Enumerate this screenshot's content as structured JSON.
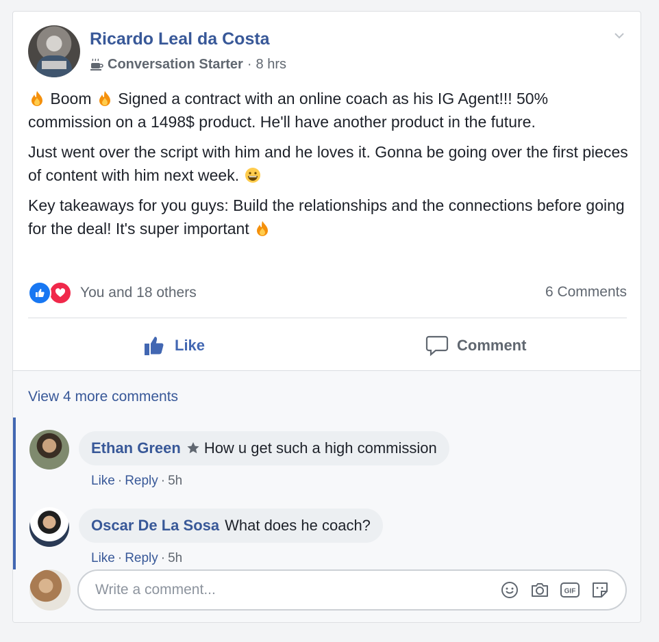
{
  "post": {
    "author": "Ricardo Leal da Costa",
    "badge_label": "Conversation Starter",
    "separator": "·",
    "time": "8 hrs",
    "text": {
      "p1_boom": "Boom",
      "p1_rest": "Signed a contract with an online coach as his IG Agent!!! 50% commission on a 1498$ product. He'll have another product in the future.",
      "p2": "Just went over the script with him and he loves it. Gonna be going over the first pieces of content with him next week.",
      "p3": "Key takeaways for you guys: Build the relationships and the connections before going for the deal! It's super important"
    },
    "reactions_text": "You and 18 others",
    "comments_count": "6 Comments"
  },
  "actions": {
    "like_label": "Like",
    "comment_label": "Comment"
  },
  "comments": {
    "view_more": "View 4 more comments",
    "items": [
      {
        "name": "Ethan Green",
        "text": "How u get such a high commission",
        "like": "Like",
        "reply": "Reply",
        "time": "5h"
      },
      {
        "name": "Oscar De La Sosa",
        "text": "What does he coach?",
        "like": "Like",
        "reply": "Reply",
        "time": "5h"
      }
    ],
    "write_placeholder": "Write a comment..."
  },
  "colors": {
    "link_blue": "#385898",
    "like_blue": "#4267b2",
    "muted": "#606770",
    "bubble": "#eceff2"
  }
}
